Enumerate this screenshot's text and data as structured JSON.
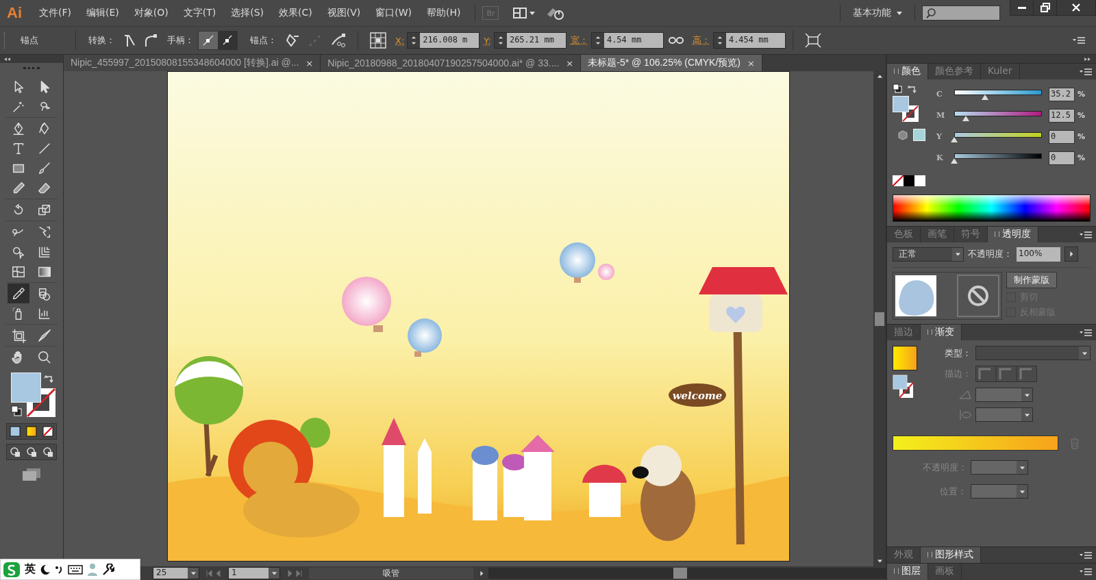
{
  "app": {
    "logo": "Ai"
  },
  "menu": [
    {
      "label": "文件(F)"
    },
    {
      "label": "编辑(E)"
    },
    {
      "label": "对象(O)"
    },
    {
      "label": "文字(T)"
    },
    {
      "label": "选择(S)"
    },
    {
      "label": "效果(C)"
    },
    {
      "label": "视图(V)"
    },
    {
      "label": "窗口(W)"
    },
    {
      "label": "帮助(H)"
    }
  ],
  "bridge": {
    "label": "Br"
  },
  "workspace": {
    "label": "基本功能"
  },
  "control_bar": {
    "context": "锚点",
    "convert": "转换：",
    "handles": "手柄：",
    "anchors": "锚点：",
    "x": {
      "label": "X:",
      "value": "216.008 m"
    },
    "y": {
      "label": "Y:",
      "value": "265.21 mm"
    },
    "width": {
      "label": "宽：",
      "value": "4.54 mm"
    },
    "height": {
      "label": "高：",
      "value": "4.454 mm"
    }
  },
  "doc_tabs": [
    {
      "title": "Nipic_455997_20150808155348604000 [转换].ai @...",
      "close": "×",
      "selected": false
    },
    {
      "title": "Nipic_20180988_20180407190257504000.ai* @ 33....",
      "close": "×",
      "selected": false
    },
    {
      "title": "未标题-5* @ 106.25% (CMYK/预览)",
      "close": "×",
      "selected": true
    }
  ],
  "tools": [
    {
      "kind": "selection",
      "selected": false
    },
    {
      "kind": "direct",
      "selected": false
    },
    {
      "kind": "wand",
      "selected": false
    },
    {
      "kind": "lasso",
      "selected": false
    },
    {
      "kind": "pen",
      "selected": false
    },
    {
      "kind": "curvature",
      "selected": false
    },
    {
      "kind": "type",
      "selected": false
    },
    {
      "kind": "line",
      "selected": false
    },
    {
      "kind": "rect",
      "selected": false
    },
    {
      "kind": "brush",
      "selected": false
    },
    {
      "kind": "pencil",
      "selected": false
    },
    {
      "kind": "eraser",
      "selected": false
    },
    {
      "kind": "rotate",
      "selected": false
    },
    {
      "kind": "scale",
      "selected": false
    },
    {
      "kind": "warp",
      "selected": false
    },
    {
      "kind": "transform",
      "selected": false
    },
    {
      "kind": "shapebuilder",
      "selected": false
    },
    {
      "kind": "perspective",
      "selected": false
    },
    {
      "kind": "mesh",
      "selected": false
    },
    {
      "kind": "gradient",
      "selected": false
    },
    {
      "kind": "eyedropper",
      "selected": true
    },
    {
      "kind": "blend",
      "selected": false
    },
    {
      "kind": "sprayer",
      "selected": false
    },
    {
      "kind": "graph",
      "selected": false
    },
    {
      "kind": "artboard",
      "selected": false
    },
    {
      "kind": "slice",
      "selected": false
    },
    {
      "kind": "hand",
      "selected": false
    },
    {
      "kind": "zoom",
      "selected": false
    }
  ],
  "color_panel": {
    "tabs": [
      {
        "label": "颜色",
        "selected": true
      },
      {
        "label": "颜色参考",
        "selected": false
      },
      {
        "label": "Kuler",
        "selected": false
      }
    ],
    "sliders": [
      {
        "label": "C",
        "level": 0.35,
        "value": "35.2",
        "unit": "%"
      },
      {
        "label": "M",
        "level": 0.13,
        "value": "12.5",
        "unit": "%"
      },
      {
        "label": "Y",
        "level": 0,
        "value": "0",
        "unit": "%"
      },
      {
        "label": "K",
        "level": 0,
        "value": "0",
        "unit": "%"
      }
    ]
  },
  "transparency_panel": {
    "tabs": [
      {
        "label": "色板",
        "selected": false
      },
      {
        "label": "画笔",
        "selected": false
      },
      {
        "label": "符号",
        "selected": false
      },
      {
        "label": "透明度",
        "selected": true
      }
    ],
    "blend_mode": "正常",
    "opacity_label": "不透明度：",
    "opacity": "100%",
    "mask_button": "制作蒙版",
    "options": [
      {
        "label": "剪切",
        "checked": false,
        "disabled": true
      },
      {
        "label": "反相蒙版",
        "checked": false,
        "disabled": true
      }
    ]
  },
  "gradient_panel": {
    "tabs": [
      {
        "label": "描边",
        "selected": false
      },
      {
        "label": "渐变",
        "selected": true
      }
    ],
    "type_label": "类型：",
    "stroke_label": "描边：",
    "opacity_label": "不透明度：",
    "position_label": "位置："
  },
  "appearance_panel": {
    "tabs": [
      {
        "label": "外观",
        "selected": false
      },
      {
        "label": "图形样式",
        "selected": true
      }
    ]
  },
  "layers_panel": {
    "tabs": [
      {
        "label": "图层",
        "selected": true
      },
      {
        "label": "画板",
        "selected": false
      }
    ]
  },
  "artwork": {
    "sign": "welcome"
  },
  "status_bar": {
    "zoom": "25",
    "page": "1",
    "tool": "吸管"
  },
  "ime_bar": {
    "mode": "英"
  }
}
